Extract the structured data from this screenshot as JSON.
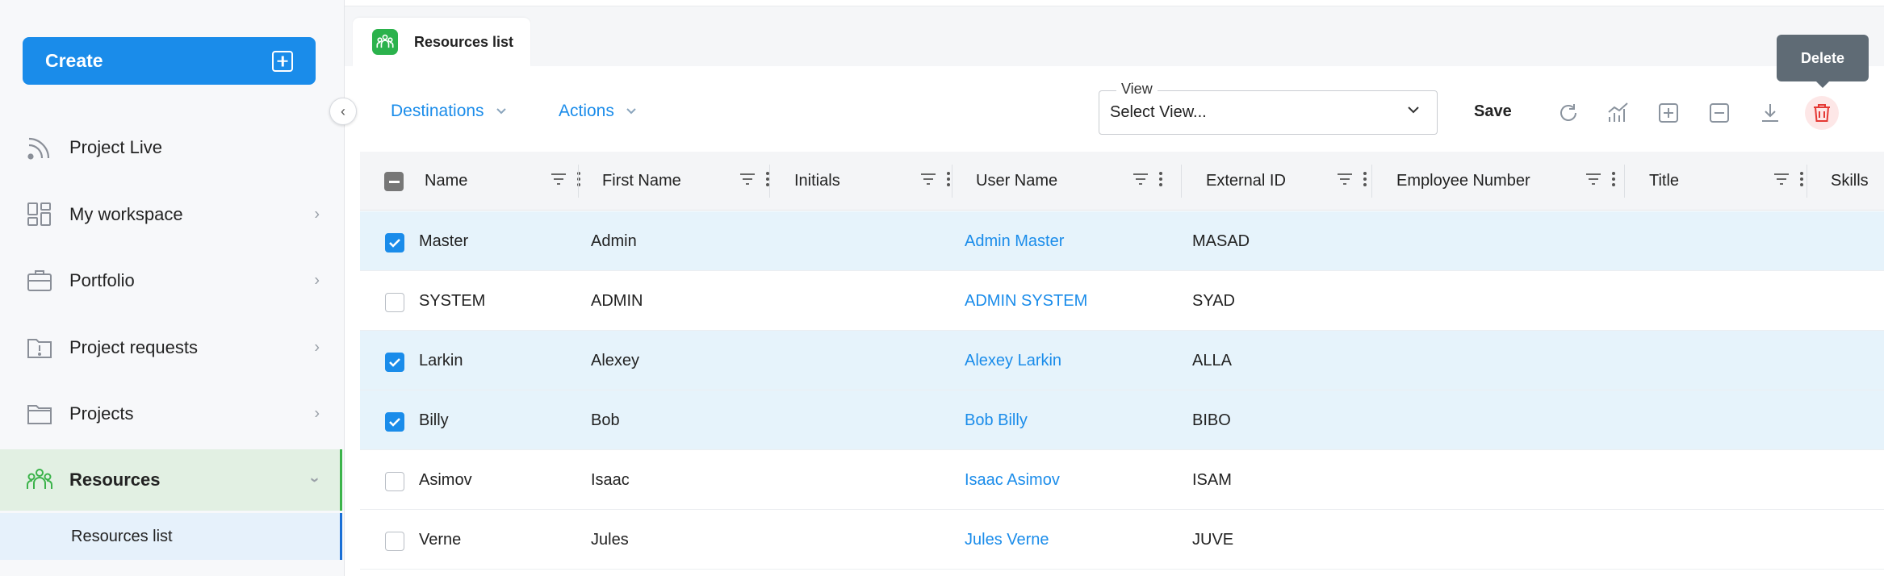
{
  "sidebar": {
    "create_label": "Create",
    "items": [
      {
        "label": "Project Live",
        "icon": "rss-icon",
        "has_chevron": false
      },
      {
        "label": "My workspace",
        "icon": "grid-icon",
        "has_chevron": true
      },
      {
        "label": "Portfolio",
        "icon": "briefcase-icon",
        "has_chevron": true
      },
      {
        "label": "Project requests",
        "icon": "folder-alert-icon",
        "has_chevron": true
      },
      {
        "label": "Projects",
        "icon": "folder-icon",
        "has_chevron": true
      },
      {
        "label": "Resources",
        "icon": "people-icon",
        "has_chevron": true
      }
    ],
    "sub_items": [
      {
        "label": "Resources list"
      }
    ]
  },
  "tab": {
    "label": "Resources list"
  },
  "toolbar": {
    "destinations_label": "Destinations",
    "actions_label": "Actions",
    "view_label": "View",
    "view_value": "Select View...",
    "save_label": "Save",
    "tooltip": "Delete"
  },
  "grid": {
    "columns": [
      "Name",
      "First Name",
      "Initials",
      "User Name",
      "External ID",
      "Employee Number",
      "Title",
      "Skills"
    ],
    "rows": [
      {
        "checked": true,
        "name": "Master",
        "first_name": "Admin",
        "initials": "",
        "user_name": "Admin Master",
        "external_id": "MASAD"
      },
      {
        "checked": false,
        "name": "SYSTEM",
        "first_name": "ADMIN",
        "initials": "",
        "user_name": "ADMIN SYSTEM",
        "external_id": "SYAD"
      },
      {
        "checked": true,
        "name": "Larkin",
        "first_name": "Alexey",
        "initials": "",
        "user_name": "Alexey Larkin",
        "external_id": "ALLA"
      },
      {
        "checked": true,
        "name": "Billy",
        "first_name": "Bob",
        "initials": "",
        "user_name": "Bob Billy",
        "external_id": "BIBO"
      },
      {
        "checked": false,
        "name": "Asimov",
        "first_name": "Isaac",
        "initials": "",
        "user_name": "Isaac Asimov",
        "external_id": "ISAM"
      },
      {
        "checked": false,
        "name": "Verne",
        "first_name": "Jules",
        "initials": "",
        "user_name": "Jules Verne",
        "external_id": "JUVE"
      }
    ]
  },
  "colors": {
    "accent": "#1a8cea",
    "active_green": "#3bb34a",
    "delete_red": "#e53935",
    "selected_row": "#e6f3fb"
  }
}
